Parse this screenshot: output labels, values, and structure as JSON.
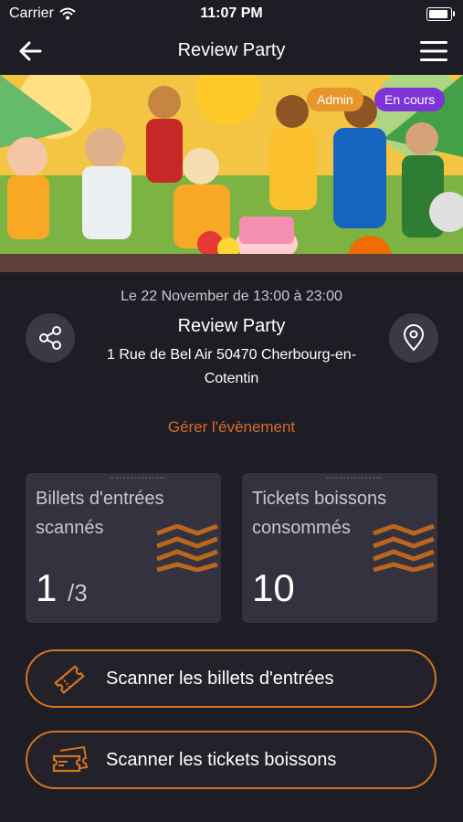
{
  "status_bar": {
    "carrier": "Carrier",
    "time": "11:07 PM"
  },
  "nav": {
    "title": "Review Party",
    "back_icon": "arrow-left-icon",
    "menu_icon": "hamburger-menu-icon"
  },
  "hero": {
    "badges": {
      "admin": "Admin",
      "status": "En cours"
    }
  },
  "event": {
    "date": "Le 22 November de 13:00 à 23:00",
    "name": "Review Party",
    "address": "1 Rue de Bel Air 50470 Cherbourg-en-Cotentin"
  },
  "manage_link": "Gérer l'évènement",
  "stats": [
    {
      "label": "Billets d'entrées scannés",
      "value": "1",
      "total": "/3"
    },
    {
      "label": "Tickets boissons consommés",
      "value": "10"
    }
  ],
  "actions": {
    "scan_entries": "Scanner les billets d'entrées",
    "scan_drinks": "Scanner les tickets boissons"
  },
  "colors": {
    "accent": "#d4741f",
    "link": "#d86a2c",
    "admin_badge": "#e6962b",
    "status_badge": "#7d33d6",
    "background": "#1e1d26",
    "card": "#33323e"
  }
}
